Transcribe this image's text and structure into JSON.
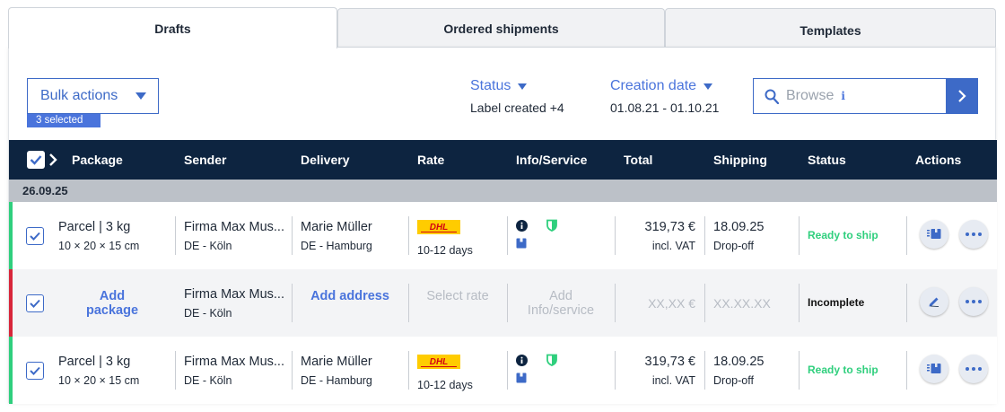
{
  "tabs": [
    {
      "label": "Drafts",
      "active": true
    },
    {
      "label": "Ordered shipments",
      "active": false
    },
    {
      "label": "Templates",
      "active": false
    }
  ],
  "toolbar": {
    "bulk_label": "Bulk actions",
    "selected_label": "3 selected",
    "status_title": "Status",
    "status_value": "Label created +4",
    "date_title": "Creation date",
    "date_value": "01.08.21 - 01.10.21",
    "search_placeholder": "Browse",
    "search_info": "i"
  },
  "table": {
    "headers": [
      "Package",
      "Sender",
      "Delivery",
      "Rate",
      "Info/Service",
      "Total",
      "Shipping",
      "Status",
      "Actions"
    ],
    "date_group": "26.09.25",
    "rows": [
      {
        "package": "Parcel | 3 kg",
        "package_dims": "10 × 20 × 15 cm",
        "sender": "Firma Max Mus...",
        "sender_loc": "DE - Köln",
        "delivery": "Marie Müller",
        "delivery_loc": "DE - Hamburg",
        "carrier": "DHL",
        "rate_days": "10-12 days",
        "total": "319,73 €",
        "total_note": "incl. VAT",
        "ship_date": "18.09.25",
        "ship_type": "Drop-off",
        "status": "Ready to ship"
      },
      {
        "package_link": "Add package",
        "sender": "Firma Max Mus...",
        "sender_loc": "DE - Köln",
        "delivery_link": "Add address",
        "rate_placeholder": "Select rate",
        "info_placeholder": "Add Info/service",
        "total_placeholder": "XX,XX €",
        "ship_placeholder": "XX.XX.XX",
        "status": "Incomplete"
      },
      {
        "package": "Parcel | 3 kg",
        "package_dims": "10 × 20 × 15 cm",
        "sender": "Firma Max Mus...",
        "sender_loc": "DE - Köln",
        "delivery": "Marie Müller",
        "delivery_loc": "DE - Hamburg",
        "carrier": "DHL",
        "rate_days": "10-12 days",
        "total": "319,73 €",
        "total_note": "incl. VAT",
        "ship_date": "18.09.25",
        "ship_type": "Drop-off",
        "status": "Ready to ship"
      }
    ]
  },
  "colors": {
    "accent": "#3d6ac7",
    "header_bg": "#0d2440",
    "ready": "#2fcf7d",
    "incomplete_bar": "#d8263a",
    "ok_bar": "#2fcf7d",
    "dhl_yellow": "#ffcc00",
    "dhl_red": "#d40511"
  },
  "icons": [
    "chevron-down-icon",
    "search-icon",
    "chevron-right-icon",
    "checkmark-icon",
    "info-icon",
    "shield-icon",
    "package-icon",
    "truck-icon",
    "pencil-icon",
    "more-icon"
  ]
}
